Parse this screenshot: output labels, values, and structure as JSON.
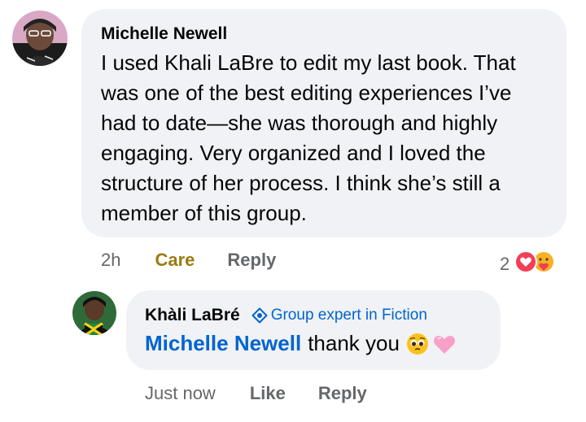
{
  "comment": {
    "author": "Michelle Newell",
    "text_lines": [
      "I used Khali LaBre to edit my last book. That",
      "was one of the best editing experiences I’ve",
      "had to date—she was thorough and highly",
      "engaging. Very organized and I loved the",
      "structure of her process. I think she’s still a",
      "member of this group."
    ],
    "time": "2h",
    "reaction_action": "Care",
    "reply_label": "Reply",
    "reaction_count": "2",
    "reaction_icons": [
      "love-icon",
      "care-icon"
    ]
  },
  "reply": {
    "author": "Khàli LaBré",
    "badge_label": "Group expert in Fiction",
    "mention": "Michelle Newell",
    "text": "thank you",
    "emojis": [
      "pleading-face-emoji",
      "pink-heart-emoji"
    ],
    "time": "Just now",
    "like_label": "Like",
    "reply_label": "Reply"
  },
  "colors": {
    "bubble": "#f0f2f5",
    "link_blue": "#0064d1",
    "care_gold": "#9b7b12",
    "meta_gray": "#65676b"
  }
}
